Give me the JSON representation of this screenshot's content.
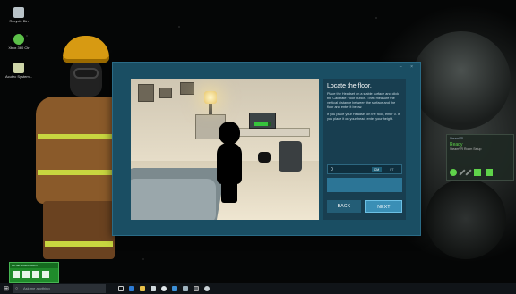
{
  "desktop": {
    "icons": [
      {
        "label": "Recycle Bin",
        "icon": "recycle-bin-icon",
        "color": "#b9c3c8"
      },
      {
        "label": "Xbox 360 Ctr",
        "icon": "xbox-icon",
        "color": "#5cc049"
      },
      {
        "label": "Acutec System...",
        "icon": "document-icon",
        "color": "#cfd6a8"
      }
    ]
  },
  "dialog": {
    "window_controls": "– ×",
    "title": "Locate the floor.",
    "instructions": "Place the Headset on a stable surface and click the Calibrate Floor button. Then measure the vertical distance between the surface and the floor and enter it below.",
    "instructions2": "If you place your Headset on the floor, enter 0. If you place it on your head, enter your height.",
    "height_value": "0",
    "unit_cm": "CM",
    "unit_ft": "FT",
    "back_label": "BACK",
    "next_label": "NEXT"
  },
  "steamvr": {
    "title": "SteamVR",
    "status": "Ready",
    "subtitle": "SteamVR Room Setup"
  },
  "mini_window": {
    "title": "Alt-Tab Rooms Room"
  },
  "taskbar": {
    "start_glyph": "⊞",
    "search_placeholder": "Ask me anything",
    "pinned": [
      "task-view-icon",
      "edge-icon",
      "file-explorer-icon",
      "store-icon",
      "steam-icon",
      "app-icon",
      "app-icon-2",
      "steamvr-icon",
      "settings-icon"
    ]
  },
  "colors": {
    "dialog_bg": "#1a4e63",
    "accent": "#3a8fb6",
    "ready_green": "#5fd34a"
  }
}
